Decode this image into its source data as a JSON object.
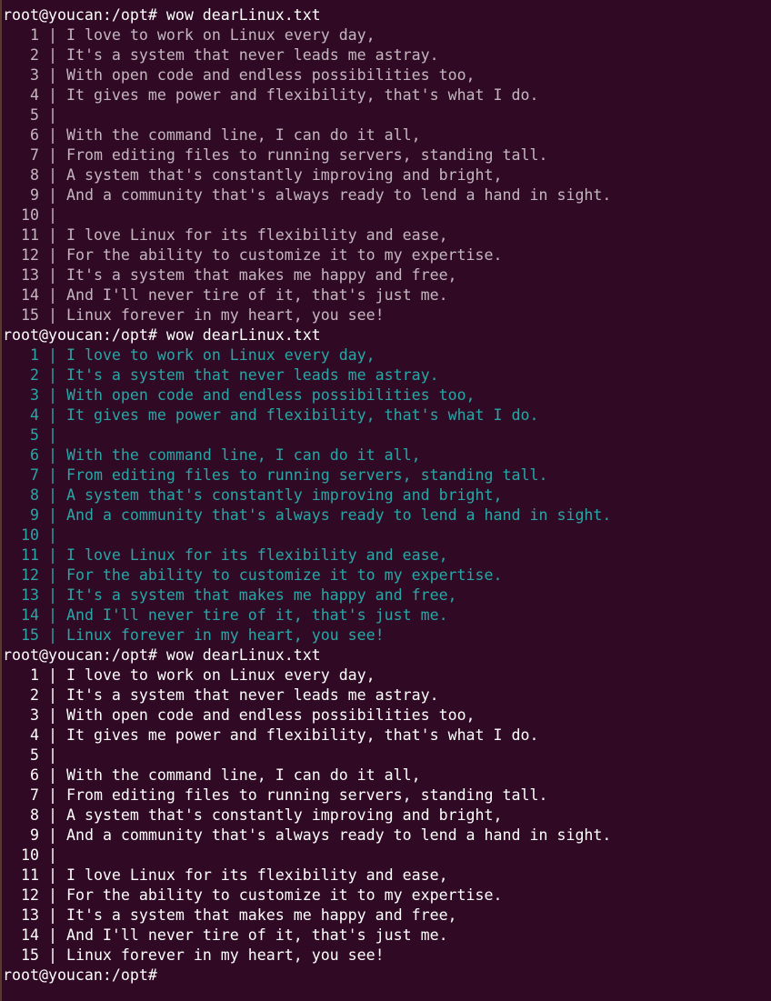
{
  "colors": {
    "background": "#300a24",
    "block_1_text": "#c4b6c0",
    "block_2_text": "#2aa6a6",
    "block_3_text": "#ffffff",
    "prompt_text": "#ffffff"
  },
  "prompt": "root@youcan:/opt#",
  "blocks": [
    {
      "command": " wow dearLinux.txt",
      "lines": [
        {
          "num": "1",
          "text": "I love to work on Linux every day,"
        },
        {
          "num": "2",
          "text": "It's a system that never leads me astray."
        },
        {
          "num": "3",
          "text": "With open code and endless possibilities too,"
        },
        {
          "num": "4",
          "text": "It gives me power and flexibility, that's what I do."
        },
        {
          "num": "5",
          "text": ""
        },
        {
          "num": "6",
          "text": "With the command line, I can do it all,"
        },
        {
          "num": "7",
          "text": "From editing files to running servers, standing tall."
        },
        {
          "num": "8",
          "text": "A system that's constantly improving and bright,"
        },
        {
          "num": "9",
          "text": "And a community that's always ready to lend a hand in sight."
        },
        {
          "num": "10",
          "text": ""
        },
        {
          "num": "11",
          "text": "I love Linux for its flexibility and ease,"
        },
        {
          "num": "12",
          "text": "For the ability to customize it to my expertise."
        },
        {
          "num": "13",
          "text": "It's a system that makes me happy and free,"
        },
        {
          "num": "14",
          "text": "And I'll never tire of it, that's just me."
        },
        {
          "num": "15",
          "text": "Linux forever in my heart, you see!"
        }
      ]
    },
    {
      "command": " wow dearLinux.txt",
      "lines": [
        {
          "num": "1",
          "text": "I love to work on Linux every day,"
        },
        {
          "num": "2",
          "text": "It's a system that never leads me astray."
        },
        {
          "num": "3",
          "text": "With open code and endless possibilities too,"
        },
        {
          "num": "4",
          "text": "It gives me power and flexibility, that's what I do."
        },
        {
          "num": "5",
          "text": ""
        },
        {
          "num": "6",
          "text": "With the command line, I can do it all,"
        },
        {
          "num": "7",
          "text": "From editing files to running servers, standing tall."
        },
        {
          "num": "8",
          "text": "A system that's constantly improving and bright,"
        },
        {
          "num": "9",
          "text": "And a community that's always ready to lend a hand in sight."
        },
        {
          "num": "10",
          "text": ""
        },
        {
          "num": "11",
          "text": "I love Linux for its flexibility and ease,"
        },
        {
          "num": "12",
          "text": "For the ability to customize it to my expertise."
        },
        {
          "num": "13",
          "text": "It's a system that makes me happy and free,"
        },
        {
          "num": "14",
          "text": "And I'll never tire of it, that's just me."
        },
        {
          "num": "15",
          "text": "Linux forever in my heart, you see!"
        }
      ]
    },
    {
      "command": " wow dearLinux.txt",
      "lines": [
        {
          "num": "1",
          "text": "I love to work on Linux every day,"
        },
        {
          "num": "2",
          "text": "It's a system that never leads me astray."
        },
        {
          "num": "3",
          "text": "With open code and endless possibilities too,"
        },
        {
          "num": "4",
          "text": "It gives me power and flexibility, that's what I do."
        },
        {
          "num": "5",
          "text": ""
        },
        {
          "num": "6",
          "text": "With the command line, I can do it all,"
        },
        {
          "num": "7",
          "text": "From editing files to running servers, standing tall."
        },
        {
          "num": "8",
          "text": "A system that's constantly improving and bright,"
        },
        {
          "num": "9",
          "text": "And a community that's always ready to lend a hand in sight."
        },
        {
          "num": "10",
          "text": ""
        },
        {
          "num": "11",
          "text": "I love Linux for its flexibility and ease,"
        },
        {
          "num": "12",
          "text": "For the ability to customize it to my expertise."
        },
        {
          "num": "13",
          "text": "It's a system that makes me happy and free,"
        },
        {
          "num": "14",
          "text": "And I'll never tire of it, that's just me."
        },
        {
          "num": "15",
          "text": "Linux forever in my heart, you see!"
        }
      ]
    }
  ],
  "final_prompt": "root@youcan:/opt#"
}
